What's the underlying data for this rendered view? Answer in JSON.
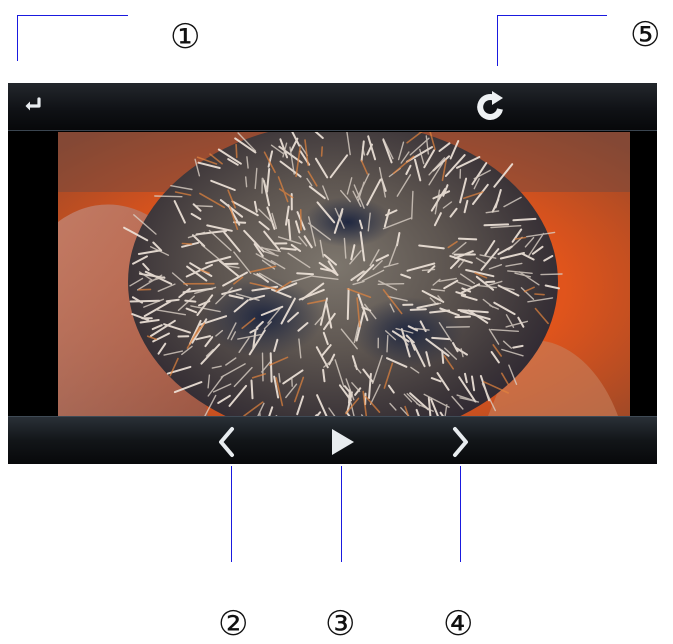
{
  "callouts": [
    {
      "id": "1",
      "label": "①"
    },
    {
      "id": "2",
      "label": "②"
    },
    {
      "id": "3",
      "label": "③"
    },
    {
      "id": "4",
      "label": "④"
    },
    {
      "id": "5",
      "label": "⑤"
    }
  ],
  "viewer": {
    "top_bar": {
      "back_icon": "return-arrow-icon",
      "rotate_icon": "rotate-clockwise-icon"
    },
    "photo": {
      "subject": "sea-urchin-photo"
    },
    "bottom_bar": {
      "prev_icon": "chevron-left-icon",
      "play_icon": "play-icon",
      "next_icon": "chevron-right-icon"
    }
  },
  "colors": {
    "callout_line": "#1a1adf",
    "bar_dark": "#07080a",
    "icon": "#e8ecef"
  }
}
